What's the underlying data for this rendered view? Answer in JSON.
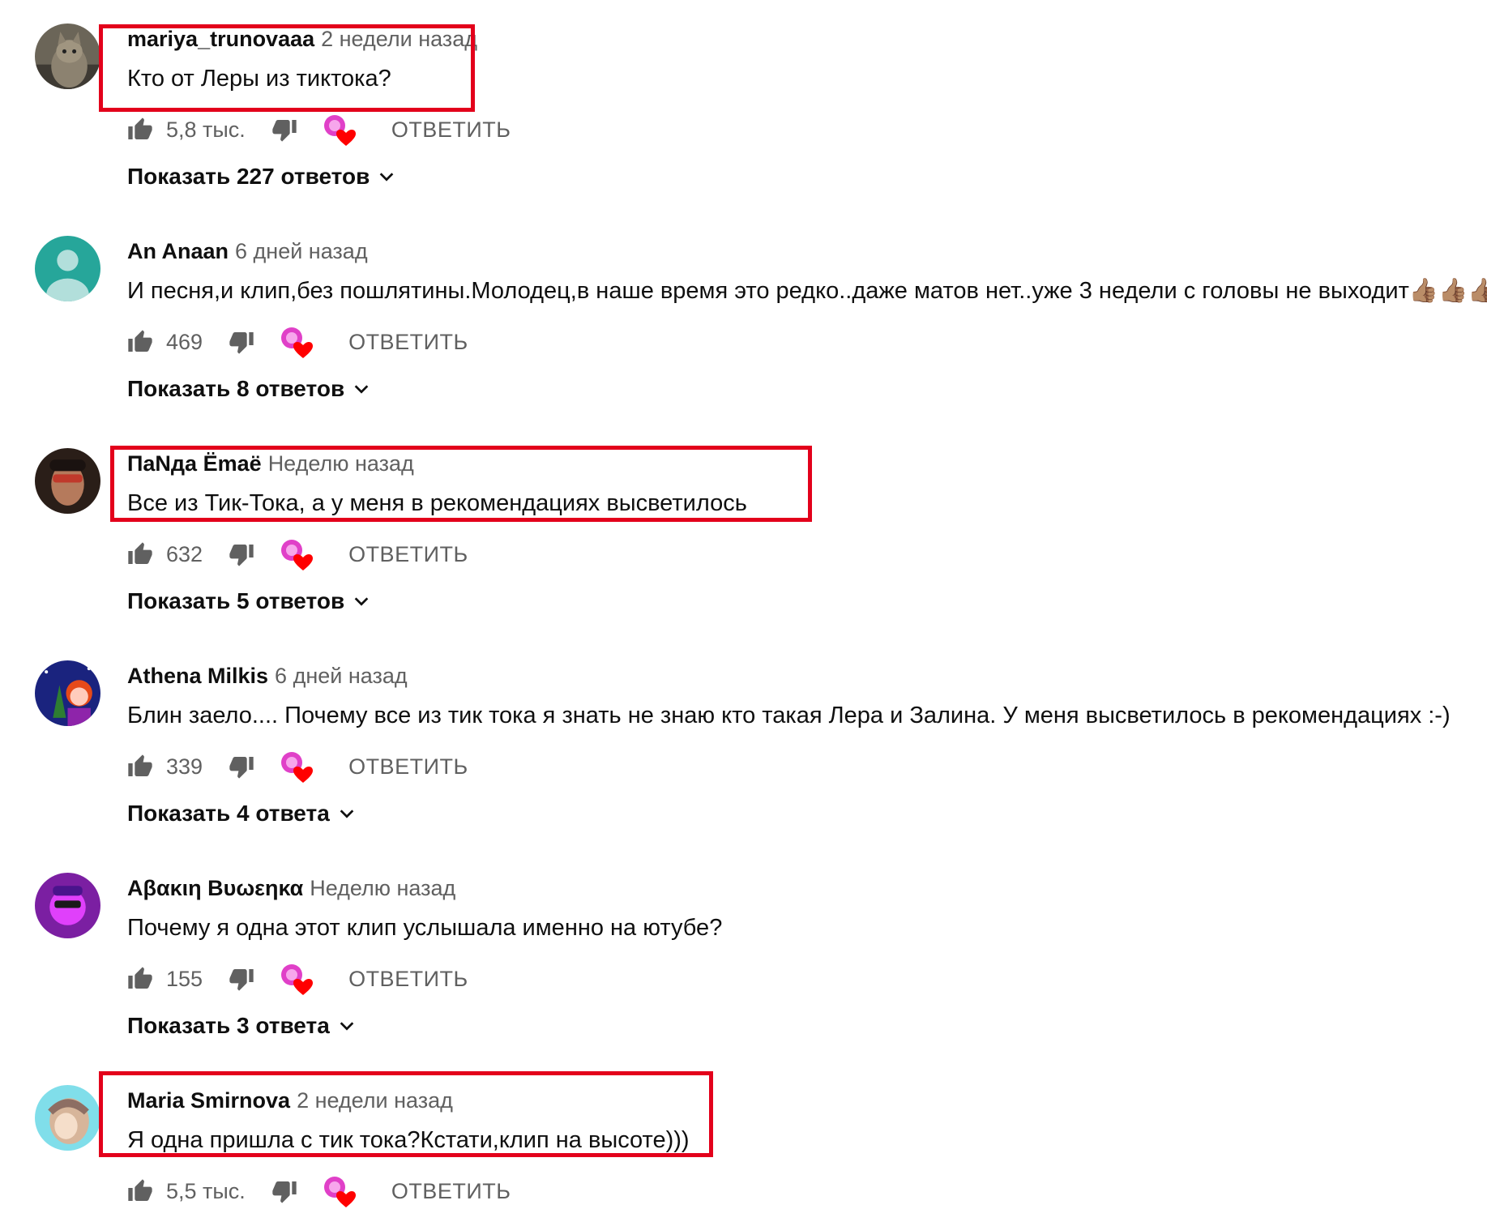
{
  "reply_label": "ОТВЕТИТЬ",
  "colors": {
    "highlight": "#e3001b",
    "heart": "#ff0000",
    "badge": "#e040c8"
  },
  "comments": [
    {
      "author": "mariya_trunovaaa",
      "time": "2 недели назад",
      "text": "Кто от Леры из тиктока?",
      "likes": "5,8 тыс.",
      "show_replies": "Показать 227 ответов",
      "avatar": "cat-photo-avatar",
      "highlighted": true
    },
    {
      "author": "An Anaan",
      "time": "6 дней назад",
      "text": "И песня,и клип,без пошлятины.Молодец,в наше время это редко..даже матов нет..уже 3 недели с головы не выходит",
      "text_emoji": "👍🏽👍🏽👍🏽",
      "likes": "469",
      "show_replies": "Показать 8 ответов",
      "avatar": "default-user-avatar",
      "highlighted": false
    },
    {
      "author": "ПаNда Ёmаё",
      "time": "Неделю назад",
      "text": "Все из Тик-Тока, а у меня в рекомендациях высветилось",
      "likes": "632",
      "show_replies": "Показать 5 ответов",
      "avatar": "sunglasses-photo-avatar",
      "highlighted": true
    },
    {
      "author": "Athena Milkis",
      "time": "6 дней назад",
      "text": "Блин заело.... Почему все из тик тока я знать не знаю кто такая Лера и Залина. У меня высветилось в рекомендациях :-)",
      "likes": "339",
      "show_replies": "Показать 4 ответа",
      "avatar": "cartoon-girl-avatar",
      "highlighted": false
    },
    {
      "author": "Αβακιη Βυωεηκα",
      "time": "Неделю назад",
      "text": "Почему я одна этот клип услышала именно на ютубе?",
      "likes": "155",
      "show_replies": "Показать 3 ответа",
      "avatar": "purple-neon-avatar",
      "highlighted": false
    },
    {
      "author": "Maria Smirnova",
      "time": "2 недели назад",
      "text": "Я одна пришла с тик тока?Кстати,клип на высоте)))",
      "likes": "5,5 тыс.",
      "show_replies": "",
      "avatar": "drawn-girl-avatar",
      "highlighted": true
    }
  ]
}
